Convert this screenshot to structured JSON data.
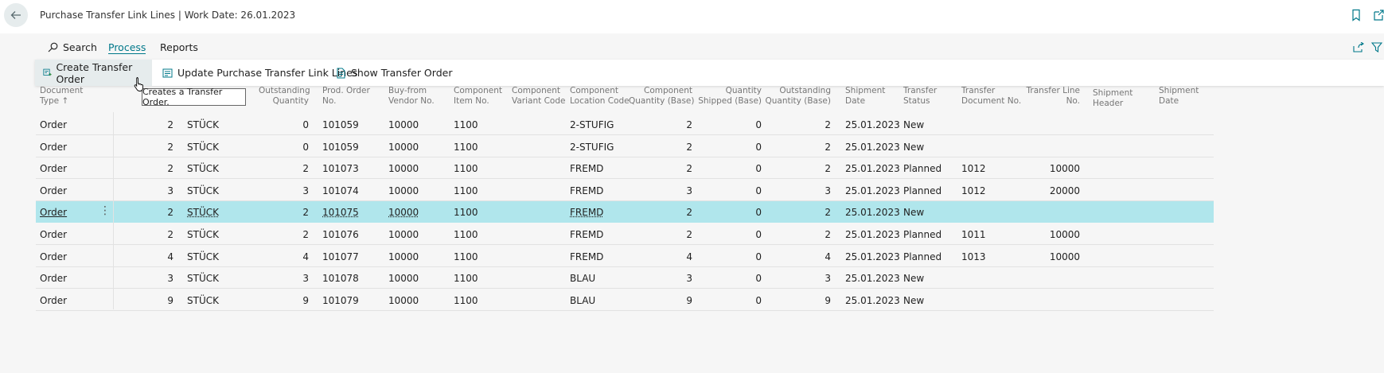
{
  "page": {
    "title": "Purchase Transfer Link Lines | Work Date: 26.01.2023"
  },
  "icons": {
    "back": "arrow-left-icon",
    "bookmark": "bookmark-icon",
    "popout": "popout-icon",
    "search": "search-icon",
    "share": "share-icon",
    "filter": "filter-icon",
    "create": "create-transfer-order-icon",
    "update": "update-lines-icon",
    "show": "show-document-icon"
  },
  "colors": {
    "accent": "#00788a",
    "selected_row": "#b0e6ec",
    "hover": "#e6eced"
  },
  "tabs": {
    "search": "Search",
    "process": "Process",
    "reports": "Reports"
  },
  "actions": {
    "create": "Create Transfer Order",
    "update": "Update Purchase Transfer Link Lines",
    "show": "Show Transfer Order"
  },
  "tooltip": "Creates a Transfer Order.",
  "table": {
    "headers": {
      "doc_type": [
        "Document",
        "Type ↑"
      ],
      "outstanding_qty": [
        "Outstanding",
        "Quantity"
      ],
      "prod_order": [
        "Prod. Order",
        "No."
      ],
      "vendor": [
        "Buy-from",
        "Vendor No."
      ],
      "comp_item": [
        "Component",
        "Item No."
      ],
      "comp_variant": [
        "Component",
        "Variant Code"
      ],
      "comp_location": [
        "Component",
        "Location Code"
      ],
      "comp_qty_base": [
        "Component",
        "Quantity (Base)"
      ],
      "qty_shipped": [
        "Quantity",
        "Shipped (Base)"
      ],
      "outstanding_base": [
        "Outstanding",
        "Quantity (Base)"
      ],
      "shipment_date": [
        "Shipment",
        "Date"
      ],
      "transfer_status": [
        "Transfer",
        "Status"
      ],
      "transfer_doc": [
        "Transfer",
        "Document No."
      ],
      "transfer_line": [
        "Transfer Line",
        "No."
      ],
      "shipment_header": [
        "Shipment",
        "Header"
      ],
      "shipment_date2": [
        "Shipment",
        "Date"
      ]
    },
    "rows": [
      {
        "doc_type": "Order",
        "qty": "2",
        "uom": "STÜCK",
        "outstanding_qty": "0",
        "prod_order": "101059",
        "vendor": "10000",
        "comp_item": "1100",
        "comp_location": "2-STUFIG",
        "comp_qty_base": "2",
        "qty_shipped": "0",
        "outstanding_base": "2",
        "shipment_date": "25.01.2023",
        "transfer_status": "New",
        "transfer_doc": "",
        "transfer_line": ""
      },
      {
        "doc_type": "Order",
        "qty": "2",
        "uom": "STÜCK",
        "outstanding_qty": "0",
        "prod_order": "101059",
        "vendor": "10000",
        "comp_item": "1100",
        "comp_location": "2-STUFIG",
        "comp_qty_base": "2",
        "qty_shipped": "0",
        "outstanding_base": "2",
        "shipment_date": "25.01.2023",
        "transfer_status": "New",
        "transfer_doc": "",
        "transfer_line": ""
      },
      {
        "doc_type": "Order",
        "qty": "2",
        "uom": "STÜCK",
        "outstanding_qty": "2",
        "prod_order": "101073",
        "vendor": "10000",
        "comp_item": "1100",
        "comp_location": "FREMD",
        "comp_qty_base": "2",
        "qty_shipped": "0",
        "outstanding_base": "2",
        "shipment_date": "25.01.2023",
        "transfer_status": "Planned",
        "transfer_doc": "1012",
        "transfer_line": "10000"
      },
      {
        "doc_type": "Order",
        "qty": "3",
        "uom": "STÜCK",
        "outstanding_qty": "3",
        "prod_order": "101074",
        "vendor": "10000",
        "comp_item": "1100",
        "comp_location": "FREMD",
        "comp_qty_base": "3",
        "qty_shipped": "0",
        "outstanding_base": "3",
        "shipment_date": "25.01.2023",
        "transfer_status": "Planned",
        "transfer_doc": "1012",
        "transfer_line": "20000"
      },
      {
        "doc_type": "Order",
        "qty": "2",
        "uom": "STÜCK",
        "outstanding_qty": "2",
        "prod_order": "101075",
        "vendor": "10000",
        "comp_item": "1100",
        "comp_location": "FREMD",
        "comp_qty_base": "2",
        "qty_shipped": "0",
        "outstanding_base": "2",
        "shipment_date": "25.01.2023",
        "transfer_status": "New",
        "transfer_doc": "",
        "transfer_line": ""
      },
      {
        "doc_type": "Order",
        "qty": "2",
        "uom": "STÜCK",
        "outstanding_qty": "2",
        "prod_order": "101076",
        "vendor": "10000",
        "comp_item": "1100",
        "comp_location": "FREMD",
        "comp_qty_base": "2",
        "qty_shipped": "0",
        "outstanding_base": "2",
        "shipment_date": "25.01.2023",
        "transfer_status": "Planned",
        "transfer_doc": "1011",
        "transfer_line": "10000"
      },
      {
        "doc_type": "Order",
        "qty": "4",
        "uom": "STÜCK",
        "outstanding_qty": "4",
        "prod_order": "101077",
        "vendor": "10000",
        "comp_item": "1100",
        "comp_location": "FREMD",
        "comp_qty_base": "4",
        "qty_shipped": "0",
        "outstanding_base": "4",
        "shipment_date": "25.01.2023",
        "transfer_status": "Planned",
        "transfer_doc": "1013",
        "transfer_line": "10000"
      },
      {
        "doc_type": "Order",
        "qty": "3",
        "uom": "STÜCK",
        "outstanding_qty": "3",
        "prod_order": "101078",
        "vendor": "10000",
        "comp_item": "1100",
        "comp_location": "BLAU",
        "comp_qty_base": "3",
        "qty_shipped": "0",
        "outstanding_base": "3",
        "shipment_date": "25.01.2023",
        "transfer_status": "New",
        "transfer_doc": "",
        "transfer_line": ""
      },
      {
        "doc_type": "Order",
        "qty": "9",
        "uom": "STÜCK",
        "outstanding_qty": "9",
        "prod_order": "101079",
        "vendor": "10000",
        "comp_item": "1100",
        "comp_location": "BLAU",
        "comp_qty_base": "9",
        "qty_shipped": "0",
        "outstanding_base": "9",
        "shipment_date": "25.01.2023",
        "transfer_status": "New",
        "transfer_doc": "",
        "transfer_line": ""
      }
    ],
    "selected_row": 4
  }
}
